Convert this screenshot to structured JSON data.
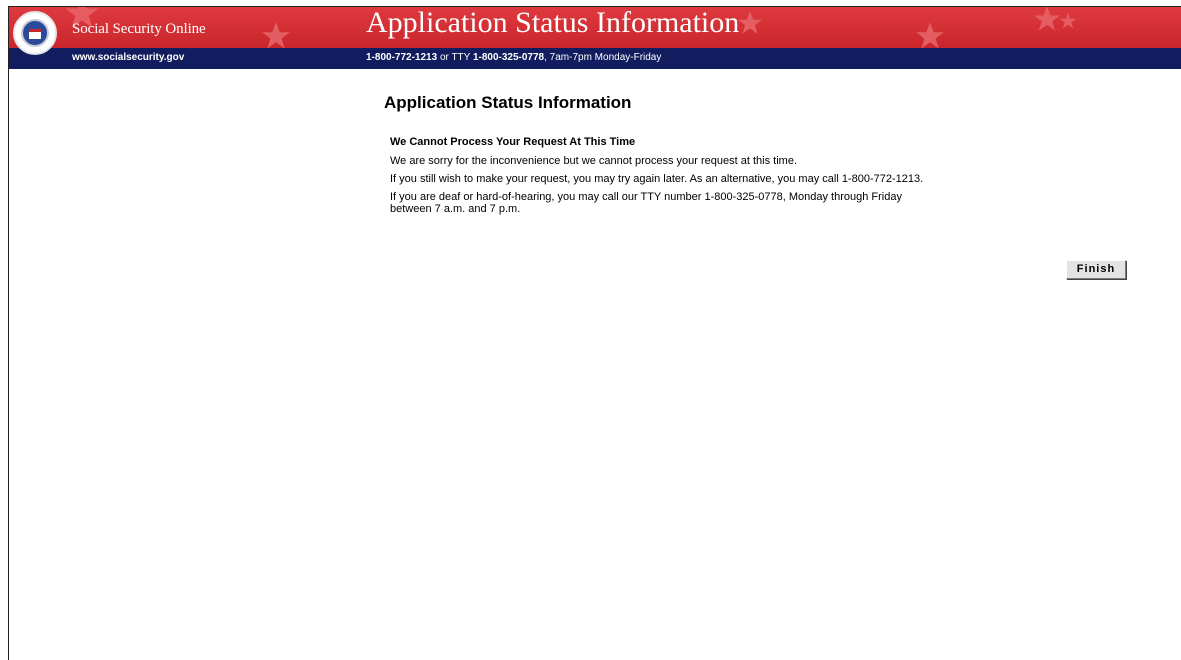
{
  "banner": {
    "site_name": "Social Security Online",
    "title": "Application Status Information",
    "site_url": "www.socialsecurity.gov",
    "contact_phone": "1-800-772-1213",
    "contact_or": " or TTY ",
    "contact_tty": "1-800-325-0778",
    "contact_hours": ", 7am-7pm Monday-Friday"
  },
  "main": {
    "heading": "Application Status Information",
    "message_heading": "We Cannot Process Your Request At This Time",
    "paragraphs": [
      "We are sorry for the inconvenience but we cannot process your request at this time.",
      "If you still wish to make your request, you may try again later. As an alternative, you may call 1-800-772-1213.",
      "If you are deaf or hard-of-hearing, you may call our TTY number 1-800-325-0778, Monday through Friday between 7 a.m. and 7 p.m."
    ],
    "finish_label": "Finish"
  },
  "colors": {
    "banner_red": "#c9262c",
    "nav_blue": "#111d5e"
  },
  "icons": {
    "seal": "ssa-seal-icon",
    "star": "star-icon"
  }
}
